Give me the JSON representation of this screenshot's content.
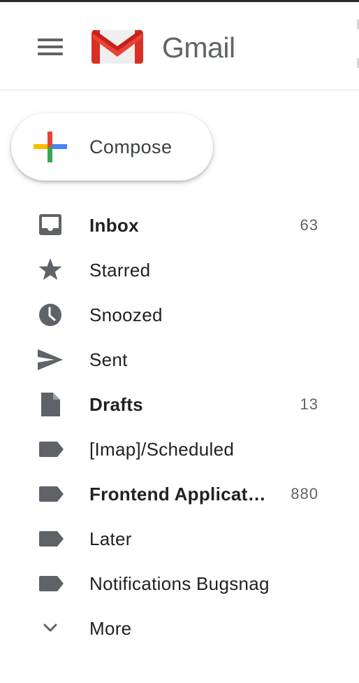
{
  "app": {
    "title": "Gmail"
  },
  "compose": {
    "label": "Compose"
  },
  "nav": {
    "items": [
      {
        "label": "Inbox",
        "count": "63",
        "icon": "inbox-icon"
      },
      {
        "label": "Starred",
        "count": "",
        "icon": "star-icon"
      },
      {
        "label": "Snoozed",
        "count": "",
        "icon": "clock-icon"
      },
      {
        "label": "Sent",
        "count": "",
        "icon": "send-icon"
      },
      {
        "label": "Drafts",
        "count": "13",
        "icon": "draft-icon"
      },
      {
        "label": "[Imap]/Scheduled",
        "count": "",
        "icon": "label-icon"
      },
      {
        "label": "Frontend Applications",
        "count": "880",
        "icon": "label-icon"
      },
      {
        "label": "Later",
        "count": "",
        "icon": "label-icon"
      },
      {
        "label": "Notifications Bugsnag",
        "count": "",
        "icon": "label-icon"
      },
      {
        "label": "More",
        "count": "",
        "icon": "chevron-down-icon"
      }
    ]
  },
  "colors": {
    "icon_gray": "#5f6368",
    "text_primary": "#202124",
    "gmail_red": "#ea4335",
    "google_blue": "#4285f4",
    "google_green": "#34a853",
    "google_yellow": "#fbbc04"
  }
}
